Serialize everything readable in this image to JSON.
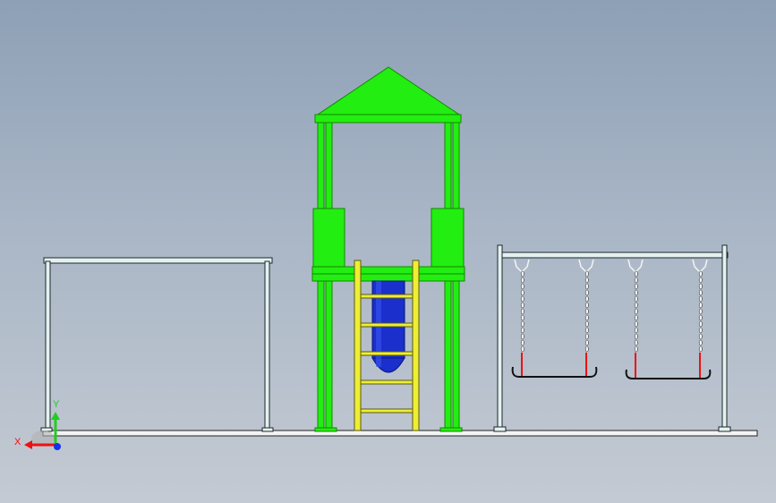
{
  "viewport": {
    "background_top": "#8ea0b6",
    "background_bottom": "#c4cad3"
  },
  "model": {
    "colors": {
      "tower": "#22ee11",
      "tower_dark": "#118800",
      "slide_tube": "#1a2fcc",
      "slide_tube_dark": "#0a157a",
      "ladder": "#eeee33",
      "frame_fill": "#e6f0f0",
      "frame_stroke": "#1a2a2a",
      "seat_stroke": "#111111",
      "rope_link": "#f4f4f4",
      "red_post": "#ee1111",
      "ground": "#f2f4f4"
    }
  },
  "triad": {
    "x_label": "X",
    "y_label": "Y",
    "x_color": "#ee1111",
    "y_color": "#22cc22",
    "z_color": "#1133ee"
  }
}
